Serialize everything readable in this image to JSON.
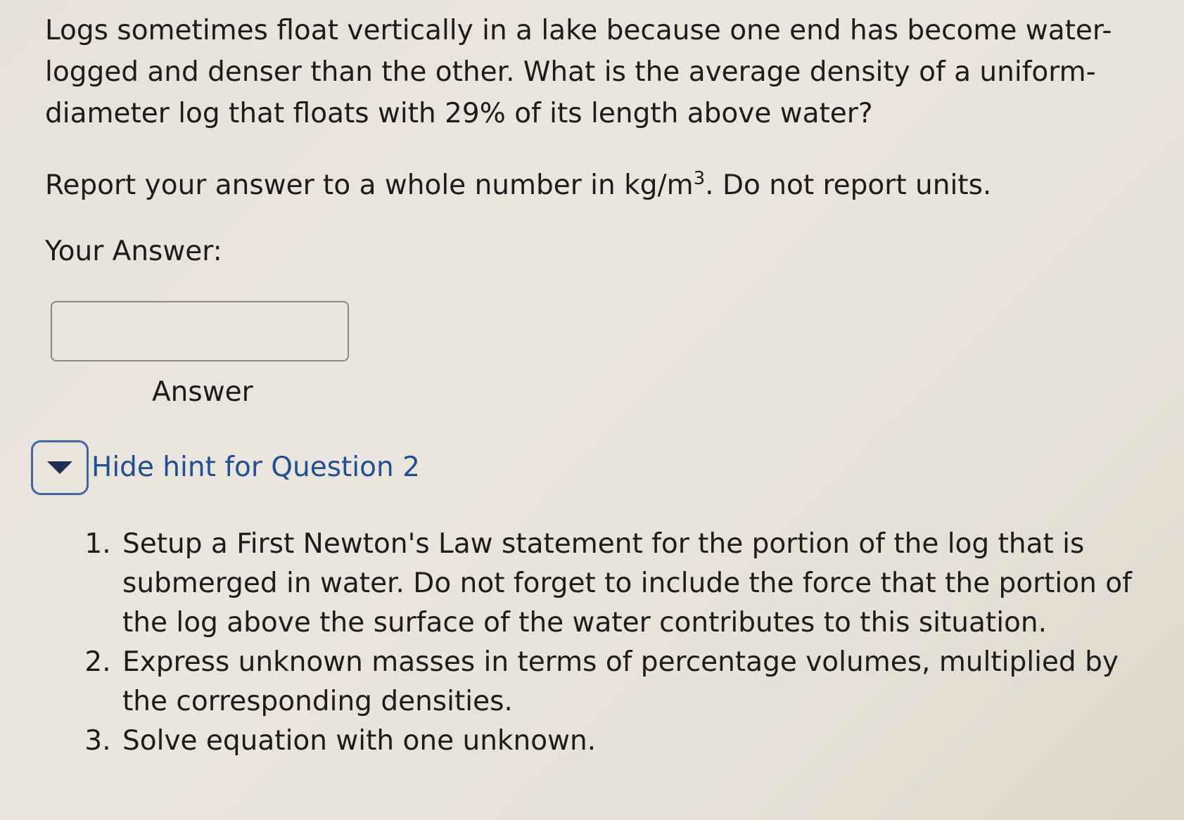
{
  "question": {
    "text": "Logs sometimes float vertically in a lake because one end has become water-logged and denser than the other. What is the average density of a uniform-diameter log that floats with 29% of its length above water?"
  },
  "instructions": {
    "before": "Report your answer to a whole number in kg/m",
    "superscript": "3",
    "after": ". Do not report units."
  },
  "answer_section": {
    "prompt": "Your Answer:",
    "input_value": "",
    "input_label": "Answer"
  },
  "hint": {
    "toggle_icon": "triangle-down-icon",
    "toggle_label": "Hide hint for Question 2",
    "accent_color": "#3f66a6",
    "items": [
      "Setup a First Newton's Law statement for the portion of the log that is submerged in water. Do not forget to include the force that the portion of the log above the surface of the water contributes to this situation.",
      "Express unknown masses in terms of percentage volumes, multiplied by the corresponding densities.",
      "Solve equation with one unknown."
    ]
  }
}
